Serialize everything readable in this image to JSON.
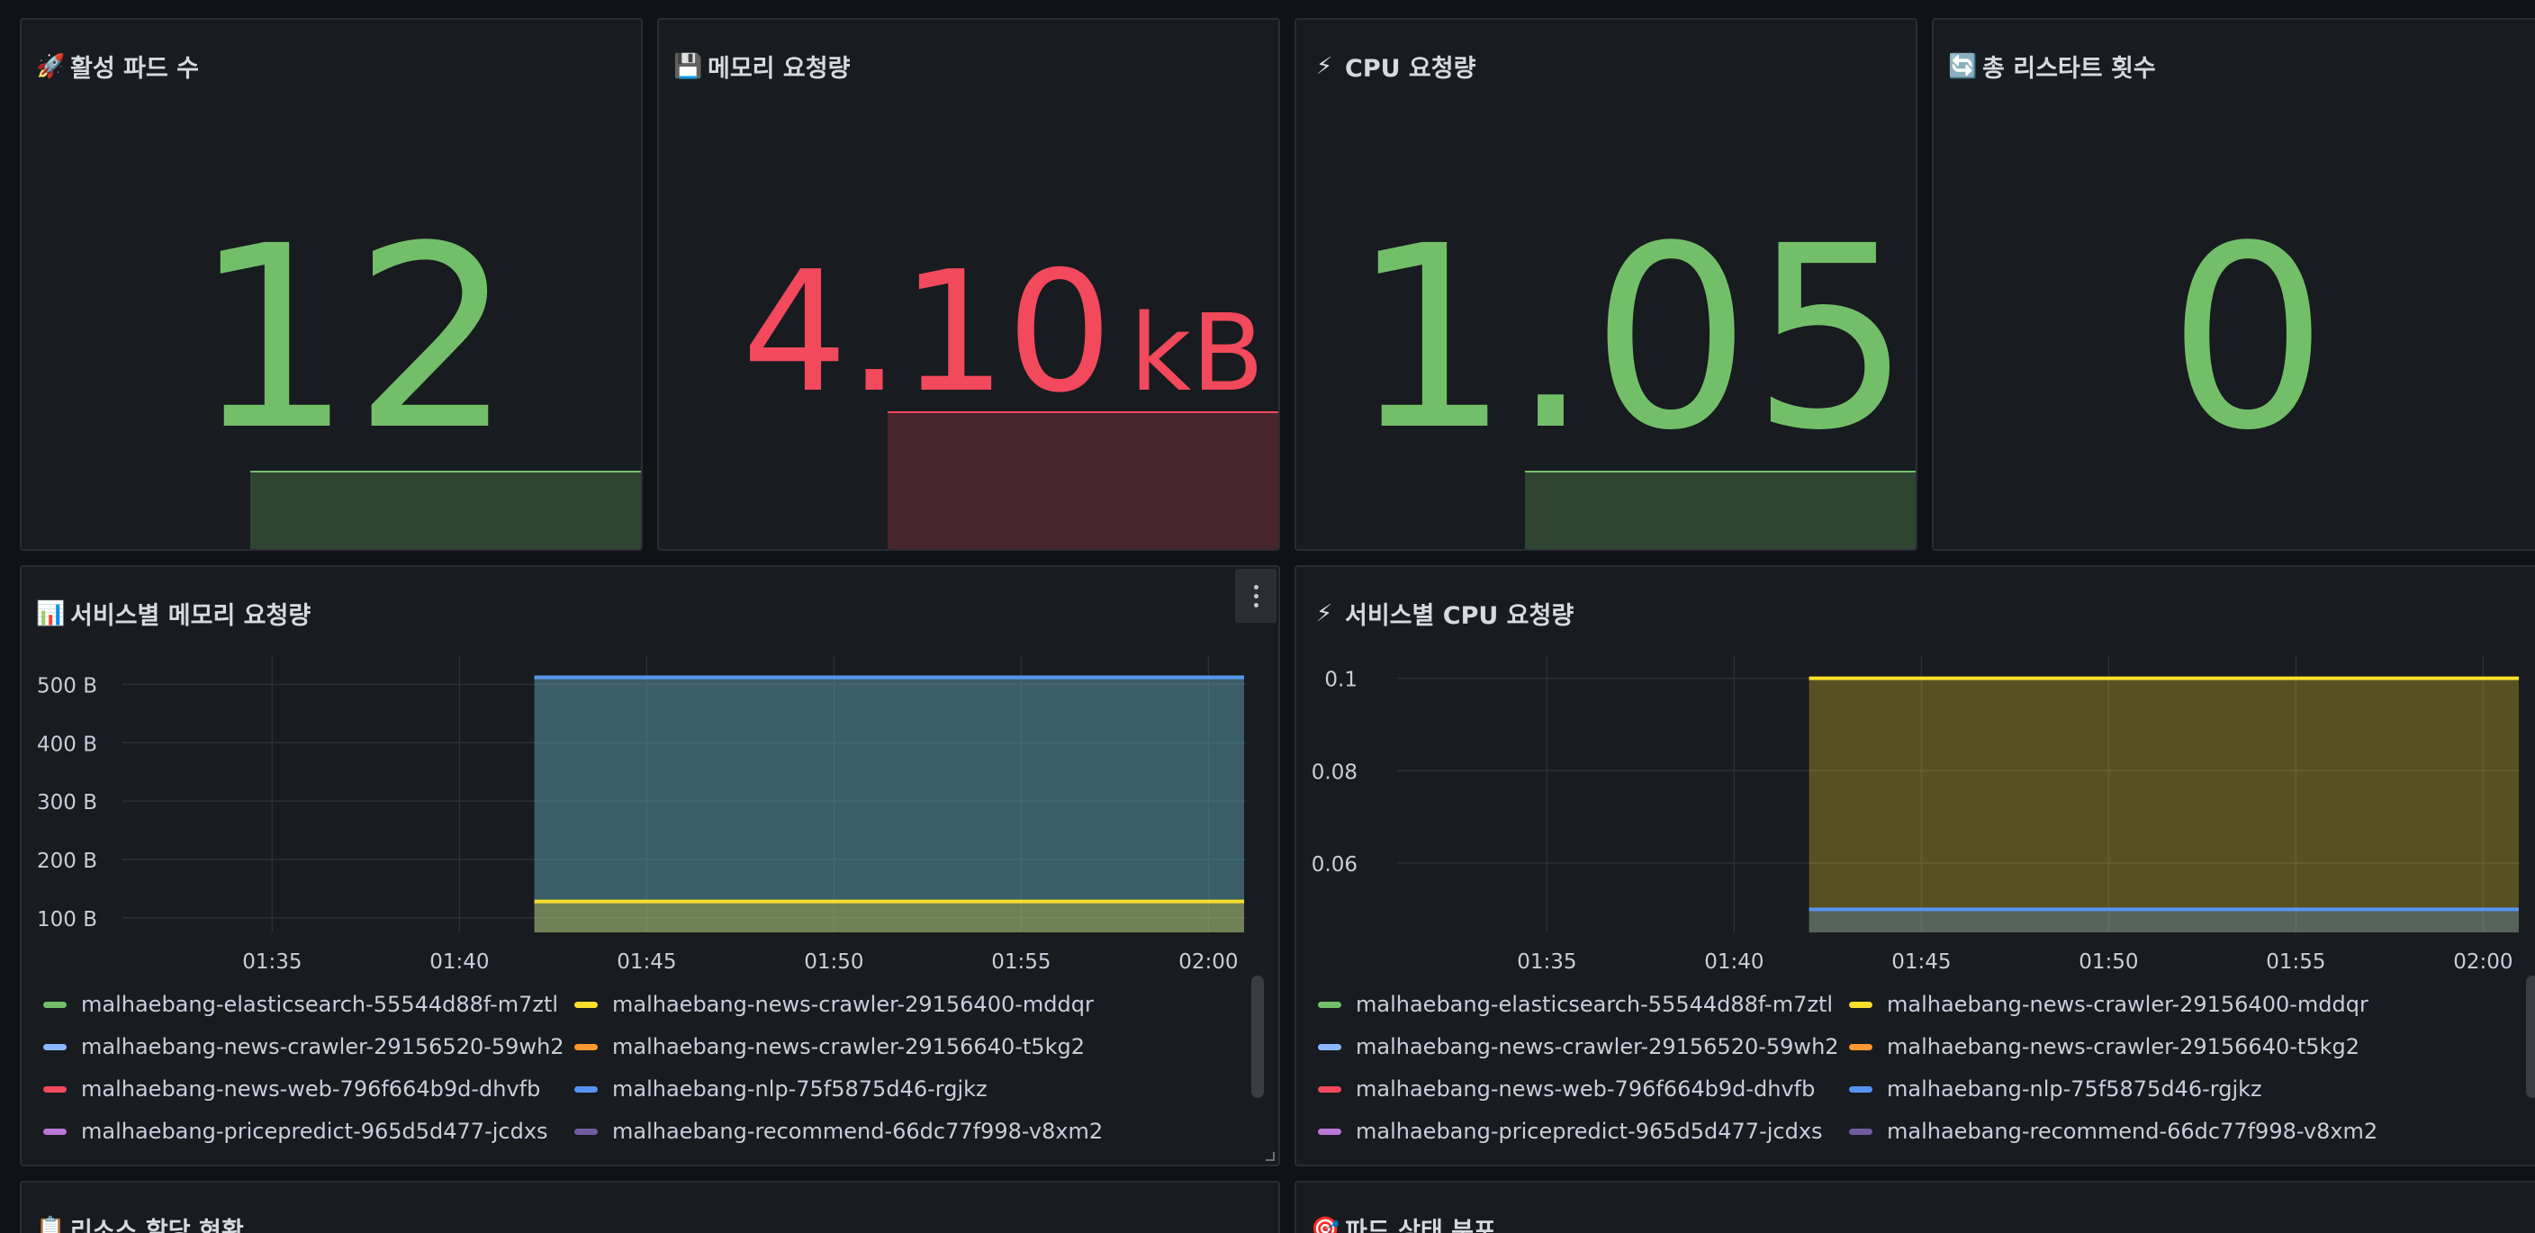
{
  "stat_panels": [
    {
      "icon": "rocket-icon",
      "emoji": "🚀",
      "title": "활성 파드 수",
      "value": "12",
      "unit": "",
      "color": "#73bf69"
    },
    {
      "icon": "floppy-disk-icon",
      "emoji": "💾",
      "title": "메모리 요청량",
      "value": "4.10",
      "unit": "kB",
      "color": "#f2495c"
    },
    {
      "icon": "lightning-icon",
      "emoji": "⚡",
      "title": "CPU 요청량",
      "value": "1.05",
      "unit": "",
      "color": "#73bf69"
    },
    {
      "icon": "refresh-icon",
      "emoji": "🔄",
      "title": "총 리스타트 횟수",
      "value": "0",
      "unit": "",
      "color": "#73bf69"
    }
  ],
  "bottom_panels": [
    {
      "icon": "clipboard-icon",
      "emoji": "📋",
      "title": "리소스 할당 현황"
    },
    {
      "icon": "target-icon",
      "emoji": "🎯",
      "title": "파드 상태 분포"
    }
  ],
  "legend": [
    {
      "name": "malhaebang-elasticsearch-55544d88f-m7ztl",
      "color": "#73bf69"
    },
    {
      "name": "malhaebang-news-crawler-29156400-mddqr",
      "color": "#fade2a"
    },
    {
      "name": "malhaebang-news-crawler-29156520-59wh2",
      "color": "#8ab8ff"
    },
    {
      "name": "malhaebang-news-crawler-29156640-t5kg2",
      "color": "#ff9830"
    },
    {
      "name": "malhaebang-news-web-796f664b9d-dhvfb",
      "color": "#f2495c"
    },
    {
      "name": "malhaebang-nlp-75f5875d46-rgjkz",
      "color": "#5794f2"
    },
    {
      "name": "malhaebang-pricepredict-965d5d477-jcdxs",
      "color": "#b877d9"
    },
    {
      "name": "malhaebang-recommend-66dc77f998-v8xm2",
      "color": "#705da0"
    }
  ],
  "chart_data": [
    {
      "type": "area",
      "title": "서비스별 메모리 요청량",
      "icon": "bar-chart-icon",
      "emoji": "📊",
      "x": [
        "01:35",
        "01:40",
        "01:45",
        "01:50",
        "01:55",
        "02:00"
      ],
      "x_range": [
        "01:31",
        "02:01"
      ],
      "data_start": "01:42",
      "y_ticks": [
        "500 B",
        "400 B",
        "300 B",
        "200 B",
        "100 B"
      ],
      "ylim": [
        75,
        550
      ],
      "series": [
        {
          "name": "malhaebang-elasticsearch-55544d88f-m7ztl",
          "color": "#73bf69",
          "value": 512
        },
        {
          "name": "malhaebang-news-crawler-29156400-mddqr",
          "color": "#fade2a",
          "value": 128
        },
        {
          "name": "malhaebang-nlp-75f5875d46-rgjkz",
          "color": "#5794f2",
          "value": 512
        }
      ]
    },
    {
      "type": "area",
      "title": "서비스별 CPU 요청량",
      "icon": "lightning-icon",
      "emoji": "⚡",
      "x": [
        "01:35",
        "01:40",
        "01:45",
        "01:50",
        "01:55",
        "02:00"
      ],
      "x_range": [
        "01:31",
        "02:01"
      ],
      "data_start": "01:42",
      "y_ticks": [
        "0.1",
        "0.08",
        "0.06"
      ],
      "ylim": [
        0.045,
        0.105
      ],
      "series": [
        {
          "name": "malhaebang-news-crawler-29156400-mddqr",
          "color": "#fade2a",
          "value": 0.1
        },
        {
          "name": "malhaebang-nlp-75f5875d46-rgjkz",
          "color": "#5794f2",
          "value": 0.05
        }
      ]
    }
  ]
}
